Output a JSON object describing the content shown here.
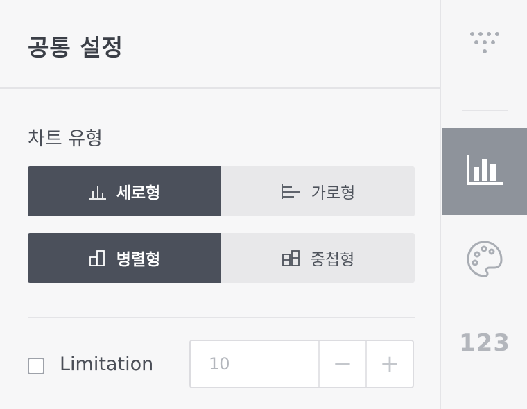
{
  "panel": {
    "title": "공통 설정",
    "chart_type_label": "차트 유형",
    "orientation": {
      "vertical_label": "세로형",
      "horizontal_label": "가로형",
      "selected": "세로형"
    },
    "layout": {
      "parallel_label": "병렬형",
      "stacked_label": "중첩형",
      "selected": "병렬형"
    },
    "limitation": {
      "label": "Limitation",
      "checked": false,
      "value": "10",
      "decrement_label": "−",
      "increment_label": "+"
    }
  },
  "rail": {
    "items": [
      {
        "icon": "filter-dots-icon"
      },
      {
        "icon": "bar-chart-icon",
        "active": true
      },
      {
        "icon": "palette-icon"
      },
      {
        "label": "123"
      }
    ]
  },
  "colors": {
    "active_segment": "#4b505b",
    "inactive_segment": "#e8e8ea",
    "rail_active": "#8e939b"
  }
}
